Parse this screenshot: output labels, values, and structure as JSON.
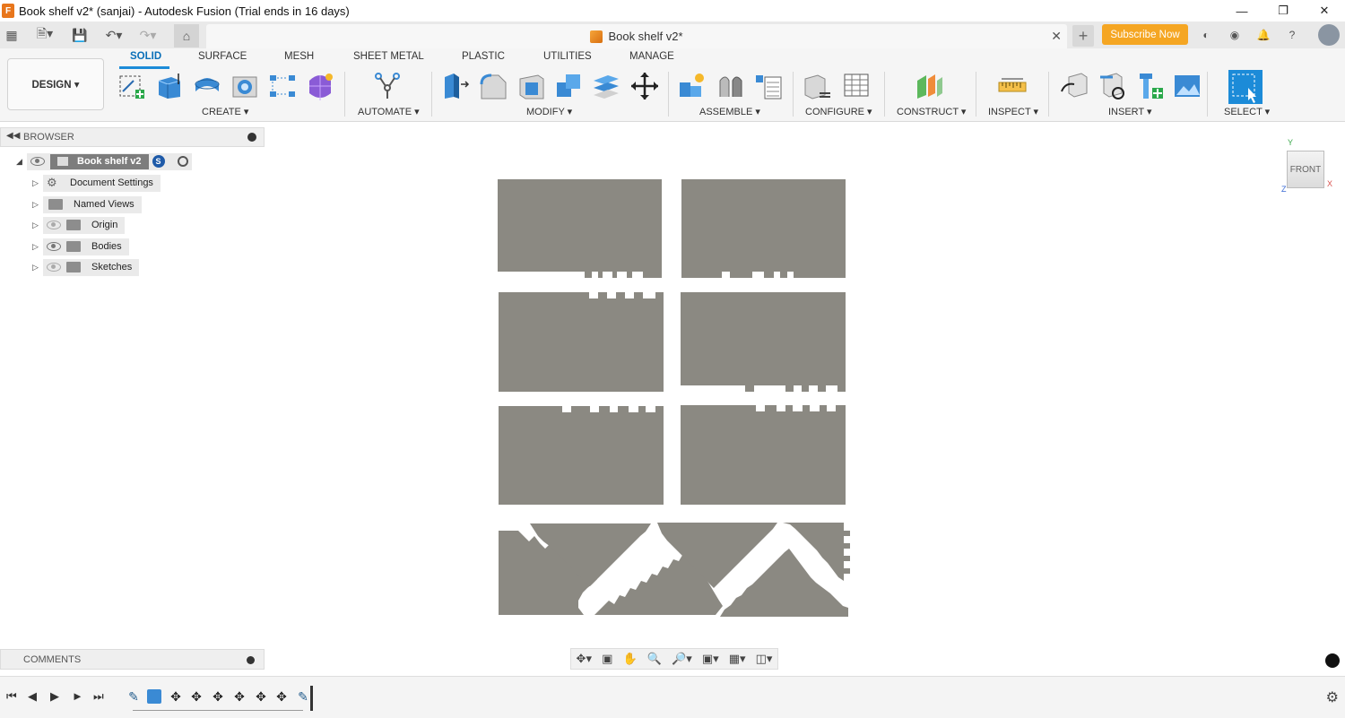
{
  "window": {
    "title": "Book shelf v2* (sanjai) - Autodesk Fusion (Trial ends in 16 days)",
    "app_icon": "F",
    "controls": [
      "minimize",
      "restore",
      "close"
    ]
  },
  "tabbar": {
    "document_tab": "Book shelf v2*",
    "subscribe_label": "Subscribe Now"
  },
  "ribbon": {
    "workspace": "DESIGN ▾",
    "tabs": [
      "SOLID",
      "SURFACE",
      "MESH",
      "SHEET METAL",
      "PLASTIC",
      "UTILITIES",
      "MANAGE"
    ],
    "groups": [
      "CREATE ▾",
      "AUTOMATE ▾",
      "MODIFY ▾",
      "ASSEMBLE ▾",
      "CONFIGURE ▾",
      "CONSTRUCT ▾",
      "INSPECT ▾",
      "INSERT ▾",
      "SELECT ▾"
    ]
  },
  "browser": {
    "header": "BROWSER",
    "root": "Book shelf v2",
    "items": [
      "Document Settings",
      "Named Views",
      "Origin",
      "Bodies",
      "Sketches"
    ]
  },
  "comments": {
    "header": "COMMENTS"
  },
  "viewcube": {
    "face": "FRONT",
    "axis_y": "Y",
    "axis_x": "X",
    "axis_z": "Z"
  },
  "colors": {
    "body_fill": "#8b8982",
    "accent": "#1c8bd8",
    "subscribe": "#f5a623"
  }
}
